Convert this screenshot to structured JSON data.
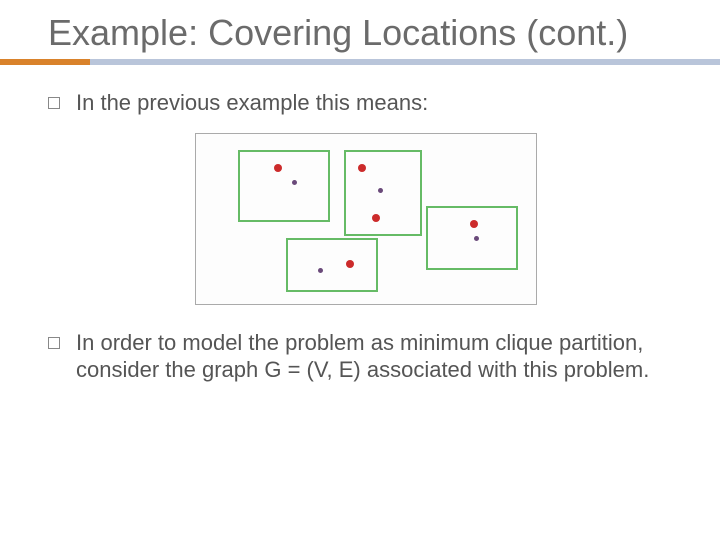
{
  "title": "Example: Covering Locations (cont.)",
  "bullets": {
    "b1": "In the previous example this means:",
    "b2": "In order to model the problem as minimum clique partition, consider the graph G = (V, E) associated with this problem."
  }
}
